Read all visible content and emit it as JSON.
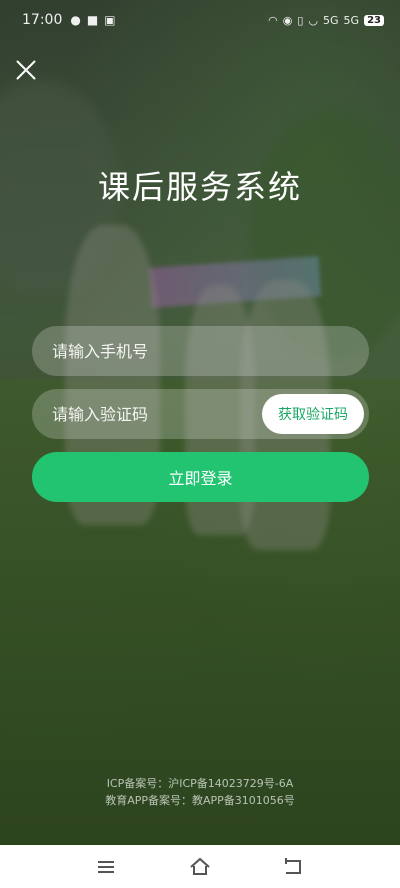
{
  "status_bar": {
    "time": "17:00",
    "battery": "23",
    "network_1": "5G",
    "network_2": "5G"
  },
  "title": "课后服务系统",
  "phone": {
    "placeholder": "请输入手机号",
    "value": ""
  },
  "code": {
    "placeholder": "请输入验证码",
    "value": "",
    "button_label": "获取验证码"
  },
  "login_label": "立即登录",
  "footer": {
    "icp": "ICP备案号：沪ICP备14023729号-6A",
    "edu": "教育APP备案号：教APP备3101056号"
  },
  "colors": {
    "primary": "#22c472",
    "code_text": "#1aa864"
  }
}
